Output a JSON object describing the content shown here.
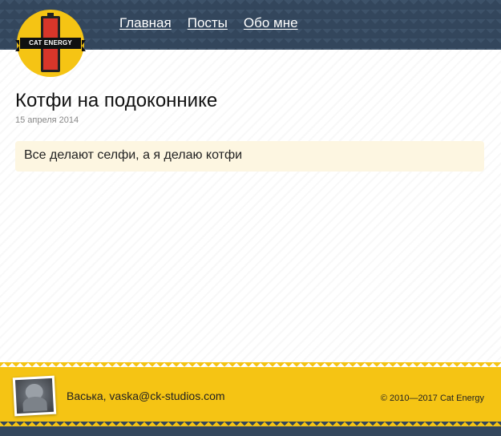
{
  "logo": {
    "text": "CAT ENERGY",
    "colors": {
      "circle": "#f5c414",
      "battery": "#d8362a"
    }
  },
  "nav": {
    "items": [
      "Главная",
      "Посты",
      "Обо мне"
    ]
  },
  "post": {
    "title": "Котфи на подоконнике",
    "date": "15 апреля 2014",
    "body": "Все делают селфи, а я делаю котфи"
  },
  "footer": {
    "author": "Васька, vaska@ck-studios.com",
    "copyright": "© 2010—2017 Cat Energy"
  },
  "colors": {
    "header_bg": "#33465c",
    "footer_bg": "#f5c414",
    "post_bg": "#fdf6e1"
  }
}
